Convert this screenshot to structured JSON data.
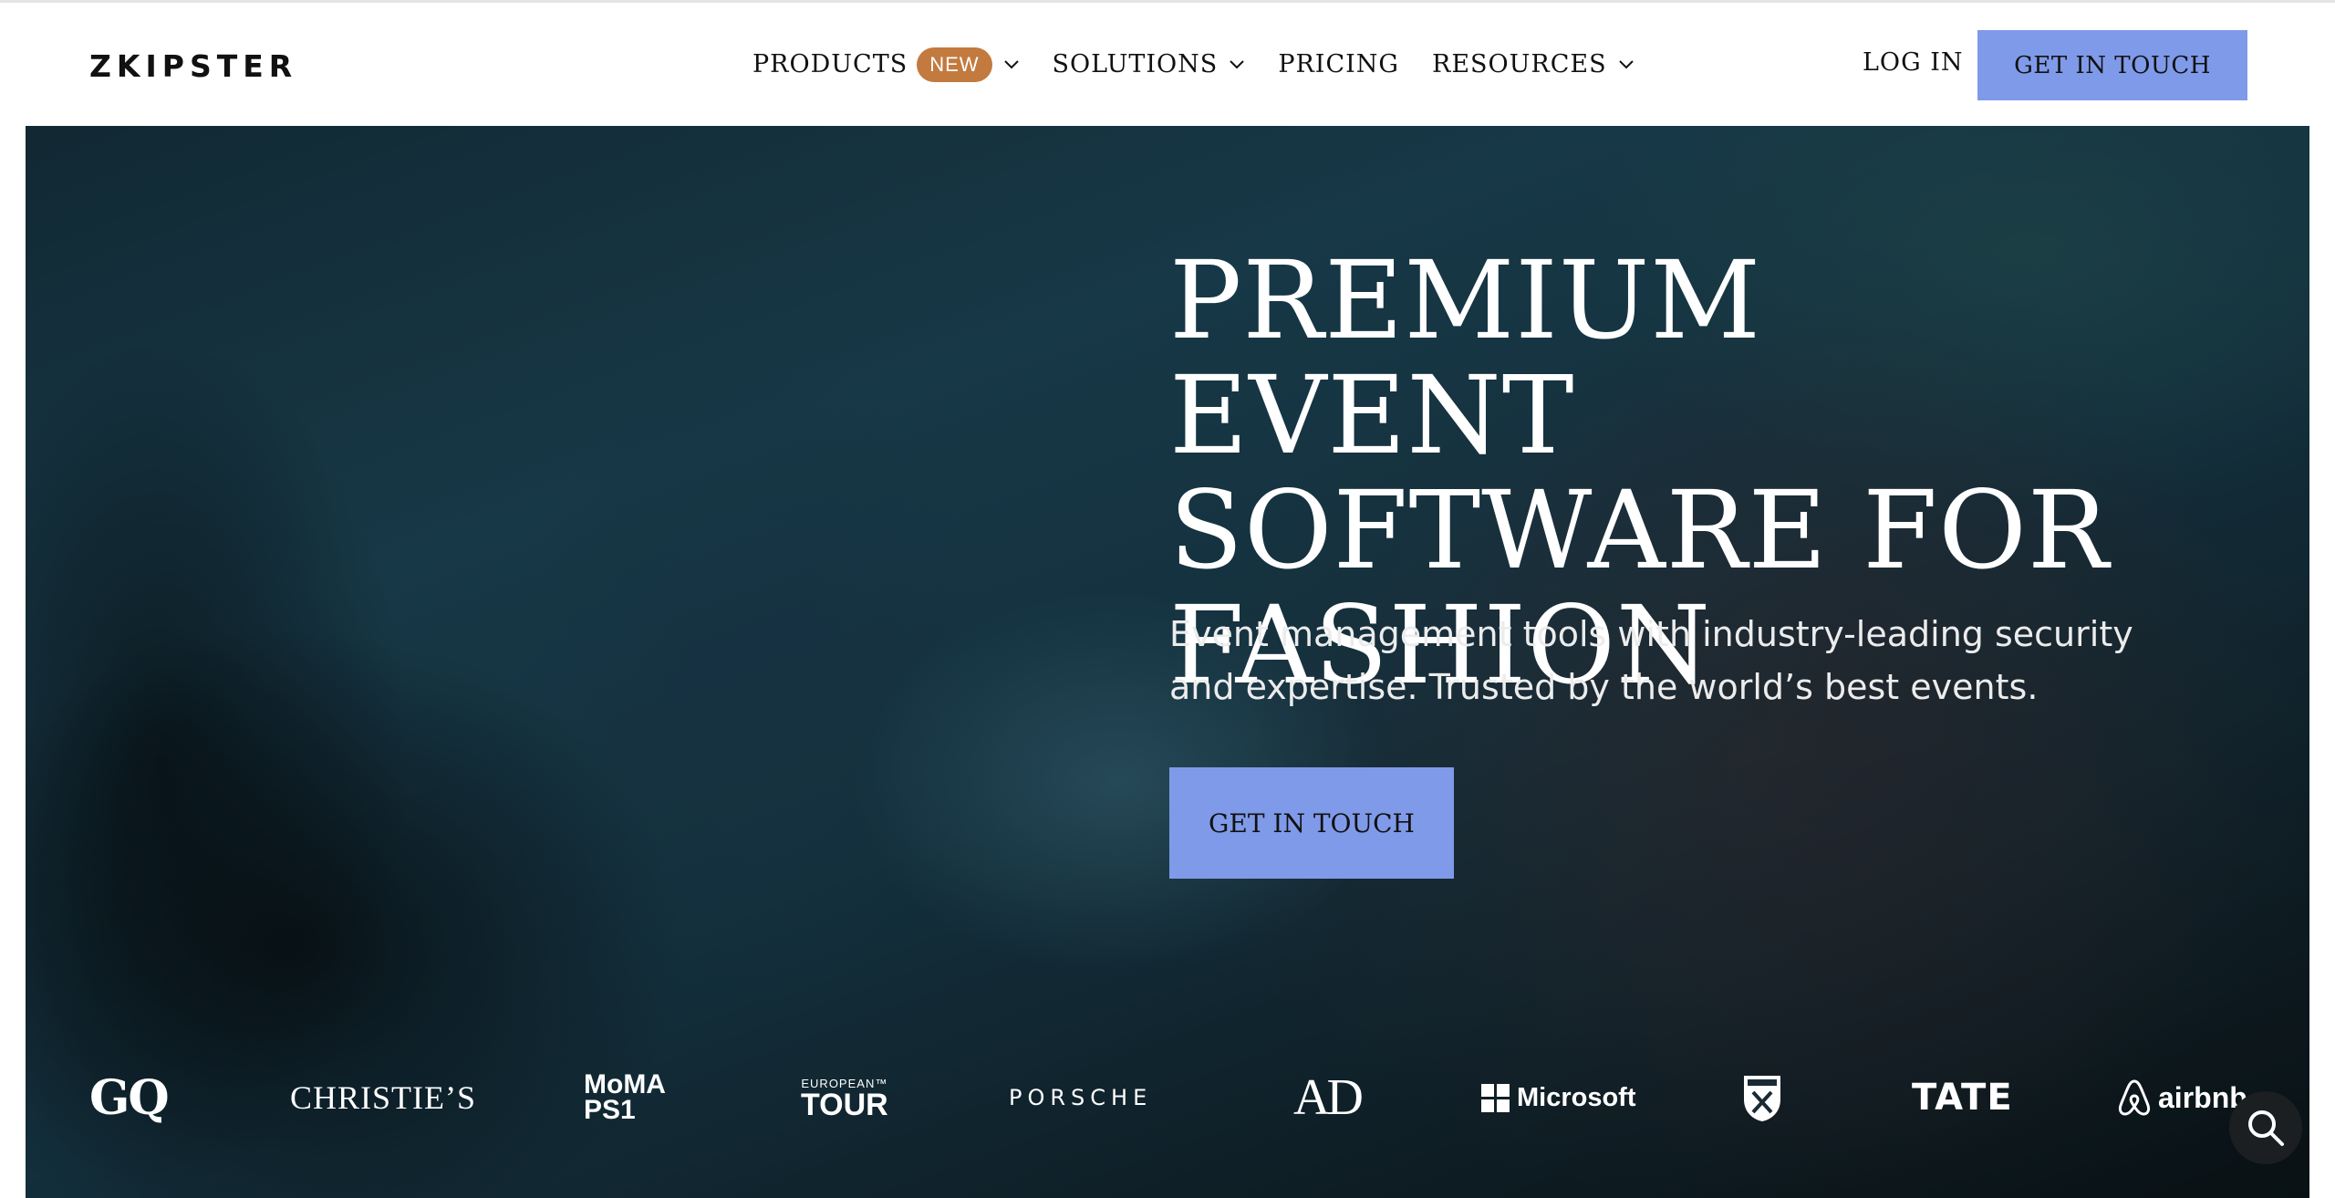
{
  "brand": {
    "logo_text": "ZKIPSTER"
  },
  "nav": {
    "items": [
      {
        "label": "PRODUCTS",
        "badge": "NEW",
        "has_dropdown": true
      },
      {
        "label": "SOLUTIONS",
        "has_dropdown": true
      },
      {
        "label": "PRICING",
        "has_dropdown": false
      },
      {
        "label": "RESOURCES",
        "has_dropdown": true
      }
    ],
    "login_label": "LOG IN",
    "cta_label": "GET IN TOUCH"
  },
  "hero": {
    "title_lines": [
      "PREMIUM EVENT",
      "SOFTWARE FOR",
      "FASHION"
    ],
    "subtitle_lines": [
      "Event management tools with industry-leading security",
      "and expertise. Trusted by the world’s best events."
    ],
    "cta_label": "GET IN TOUCH"
  },
  "client_logos": {
    "gq": "GQ",
    "christies": "CHRISTIE’S",
    "moma": [
      "MoMA",
      "PS1"
    ],
    "european_tour": [
      "EUROPEAN™",
      "TOUR"
    ],
    "porsche": "PORSCHE",
    "ad": "AD",
    "microsoft": "Microsoft",
    "west_ham": "West Ham crest",
    "tate": "TATE",
    "airbnb": "airbnb"
  },
  "search_button": {
    "icon": "search-icon"
  },
  "colors": {
    "accent_button": "#7f9ae9",
    "badge": "#c27a3e",
    "hero_overlay": "#16323f"
  }
}
